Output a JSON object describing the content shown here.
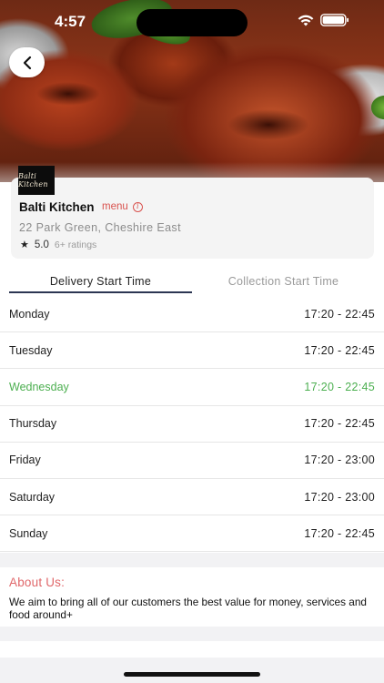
{
  "status_bar": {
    "time": "4:57"
  },
  "restaurant": {
    "logo_text": "Balti Kitchen",
    "name": "Balti Kitchen",
    "menu_label": "menu",
    "address": "22 Park Green, Cheshire East",
    "rating_score": "5.0",
    "rating_count": "6+ ratings"
  },
  "tabs": [
    {
      "label": "Delivery Start Time",
      "active": true
    },
    {
      "label": "Collection Start Time",
      "active": false
    }
  ],
  "schedule": [
    {
      "day": "Monday",
      "hours": "17:20 - 22:45"
    },
    {
      "day": "Tuesday",
      "hours": "17:20 - 22:45"
    },
    {
      "day": "Wednesday",
      "hours": "17:20 - 22:45",
      "today": true
    },
    {
      "day": "Thursday",
      "hours": "17:20 - 22:45"
    },
    {
      "day": "Friday",
      "hours": "17:20 - 23:00"
    },
    {
      "day": "Saturday",
      "hours": "17:20 - 23:00"
    },
    {
      "day": "Sunday",
      "hours": "17:20 - 22:45"
    }
  ],
  "about": {
    "title": "About Us:",
    "text": "We aim to bring all of our customers the best value for money, services and food around+"
  },
  "colors": {
    "accent_red": "#d9534f",
    "today_green": "#4caf50",
    "tab_underline": "#2c3652"
  }
}
